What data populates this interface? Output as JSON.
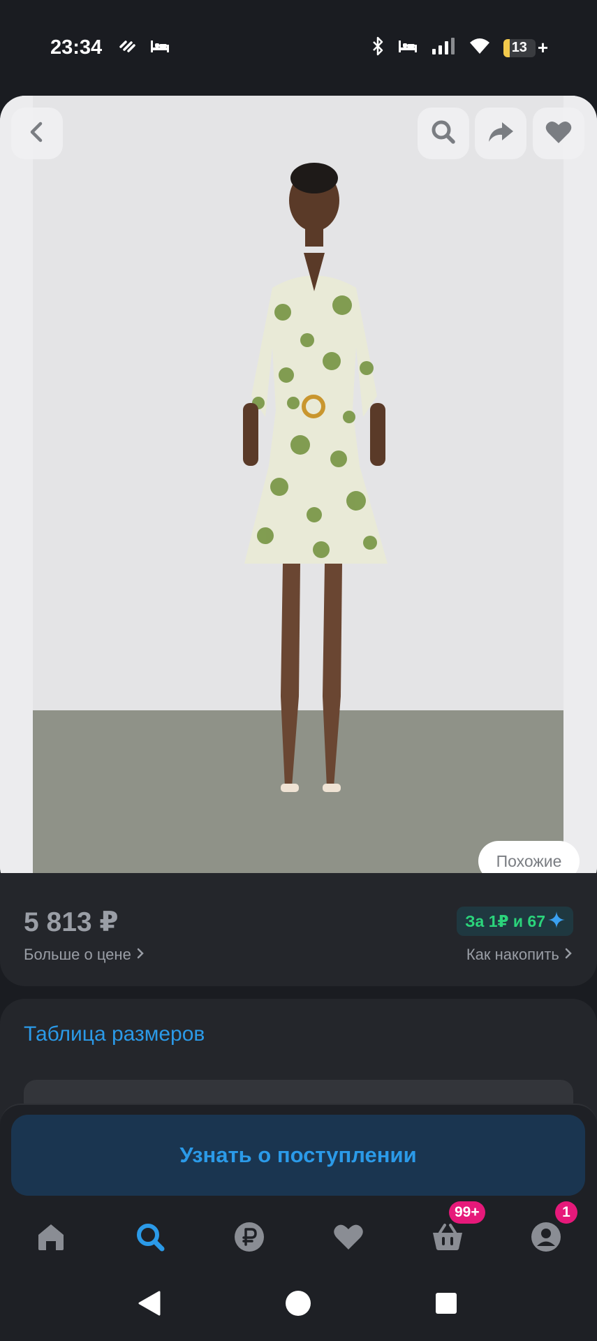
{
  "status_bar": {
    "time": "23:34",
    "battery_level": "13",
    "battery_plus": "+"
  },
  "photo": {
    "similar_label": "Похожие"
  },
  "price_block": {
    "price": "5 813 ₽",
    "more_about_price": "Больше о цене",
    "points_badge": "За 1₽ и 67",
    "how_to_save": "Как накопить"
  },
  "size_table": {
    "link_label": "Таблица размеров"
  },
  "notify_button": {
    "label": "Узнать о поступлении"
  },
  "tab_bar": {
    "cart_badge": "99+",
    "profile_badge": "1"
  },
  "colors": {
    "accent": "#2b9ae8",
    "badge": "#e6197a",
    "points": "#2bd47b",
    "background": "#1a1c21"
  }
}
